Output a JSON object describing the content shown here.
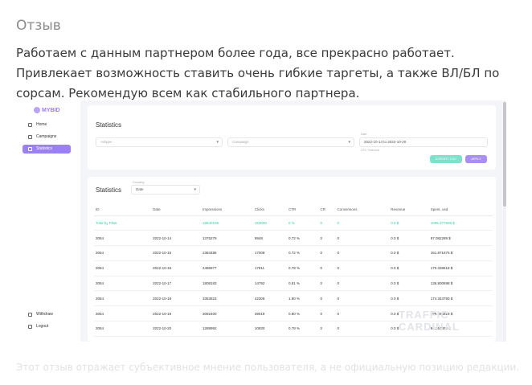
{
  "review": {
    "heading": "Отзыв",
    "text": "Работаем с данным партнером более года, все прекрасно работает. Привлекает возможность ставить очень гибкие таргеты, а также ВЛ/БЛ по сорсам. Рекомендую всем как стабильного партнера.",
    "disclaimer": "Этот отзыв отражает субъективное мнение пользователя, а не официальную позицию редакции."
  },
  "screenshot": {
    "logo": "MYBID",
    "nav": [
      {
        "label": "Home",
        "icon": "home-icon"
      },
      {
        "label": "Campaigns",
        "icon": "campaigns-icon"
      },
      {
        "label": "Statistics",
        "icon": "statistics-icon",
        "active": true
      }
    ],
    "footer_nav": [
      {
        "label": "Withdraw",
        "icon": "withdraw-icon"
      },
      {
        "label": "Logout",
        "icon": "logout-icon"
      }
    ],
    "filters": {
      "title": "Statistics",
      "adtype_placeholder": "Adtype",
      "campaign_placeholder": "Campaign",
      "date_label": "Date",
      "date_value": "2022-10-14 to 2022-10-20",
      "date_hint": "UTC Timezone",
      "export_label": "EXPORT CSV",
      "apply_label": "APPLY"
    },
    "stats": {
      "title": "Statistics",
      "grouping_label": "Grouping",
      "grouping_value": "Date",
      "columns": [
        "ID",
        "Date",
        "Impressions",
        "Clicks",
        "CTR",
        "CR",
        "Conversions",
        "Revenue",
        "Spent, usd"
      ],
      "total": [
        "Total by Filter",
        "",
        "18640108",
        "153000",
        "0 %",
        "0",
        "0",
        "0.0 $",
        "1005.377608 $"
      ],
      "rows": [
        [
          "3054",
          "2022-10-14",
          "1375279",
          "9948",
          "0.72 %",
          "0",
          "0",
          "0.0 $",
          "97.082289 $"
        ],
        [
          "3054",
          "2022-10-15",
          "2384486",
          "17008",
          "0.72 %",
          "0",
          "0",
          "0.0 $",
          "161.871675 $"
        ],
        [
          "3054",
          "2022-10-16",
          "2486977",
          "17811",
          "0.78 %",
          "0",
          "0",
          "0.0 $",
          "170.338618 $"
        ],
        [
          "3054",
          "2022-10-17",
          "1808183",
          "14792",
          "0.81 %",
          "0",
          "0",
          "0.0 $",
          "136.800698 $"
        ],
        [
          "3054",
          "2022-10-18",
          "3353823",
          "42306",
          "1.90 %",
          "0",
          "0",
          "0.0 $",
          "174.343780 $"
        ],
        [
          "3054",
          "2022-10-19",
          "3092400",
          "39019",
          "0.80 %",
          "0",
          "0",
          "0.0 $",
          "189.385819 $"
        ],
        [
          "3054",
          "2022-10-20",
          "1288992",
          "10930",
          "0.78 %",
          "0",
          "0",
          "0.0 $",
          "94.262490 $"
        ]
      ]
    },
    "watermark": "TRAFFIC CARDINAL"
  }
}
